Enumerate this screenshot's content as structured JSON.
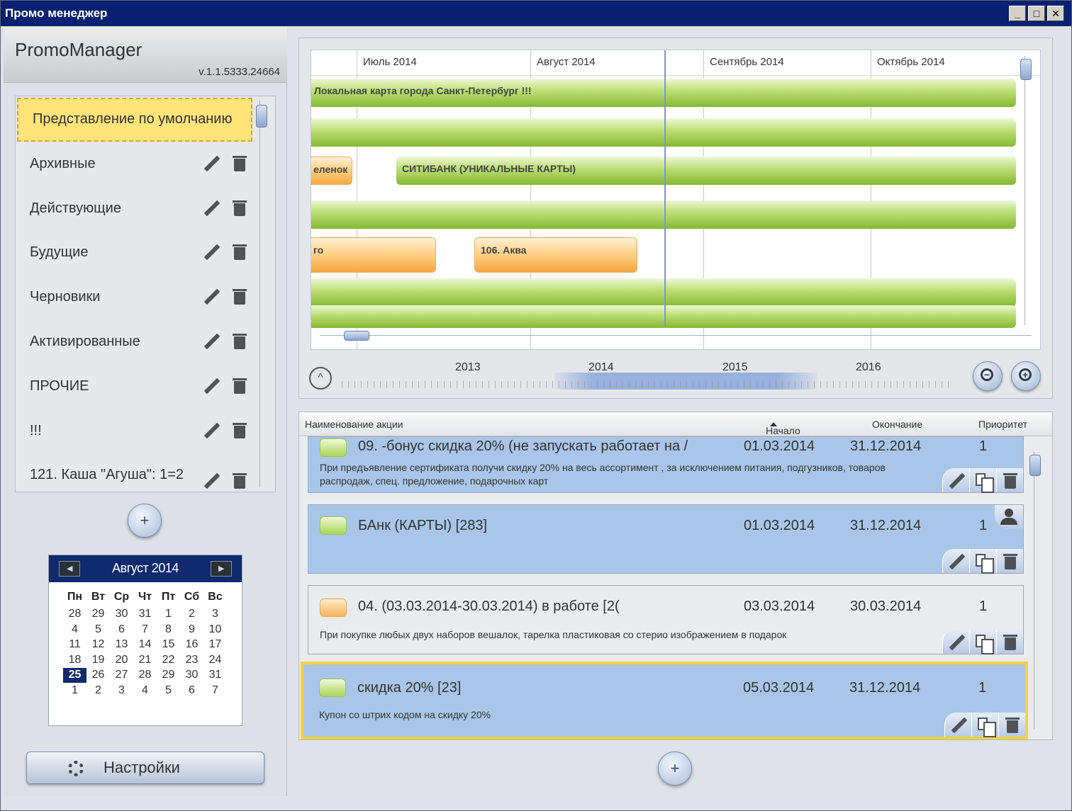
{
  "window": {
    "title": "Промо менеджер",
    "min": "_",
    "max": "□",
    "close": "✕"
  },
  "brand": {
    "name": "PromoManager",
    "version": "v.1.1.5333.24664"
  },
  "views": [
    {
      "label": "Представление по умолчанию"
    },
    {
      "label": "Архивные"
    },
    {
      "label": "Действующие"
    },
    {
      "label": "Будущие"
    },
    {
      "label": "Черновики"
    },
    {
      "label": "Активированные"
    },
    {
      "label": "ПРОЧИЕ"
    },
    {
      "label": "!!!"
    },
    {
      "label": "121. Каша \"Агуша\": 1=2"
    }
  ],
  "add_label": "+",
  "calendar": {
    "title": "Август 2014",
    "prev": "◀",
    "next": "▶",
    "dow": [
      "Пн",
      "Вт",
      "Ср",
      "Чт",
      "Пт",
      "Сб",
      "Вс"
    ],
    "days": [
      "28",
      "29",
      "30",
      "31",
      "1",
      "2",
      "3",
      "4",
      "5",
      "6",
      "7",
      "8",
      "9",
      "10",
      "11",
      "12",
      "13",
      "14",
      "15",
      "16",
      "17",
      "18",
      "19",
      "20",
      "21",
      "22",
      "23",
      "24",
      "25",
      "26",
      "27",
      "28",
      "29",
      "30",
      "31",
      "1",
      "2",
      "3",
      "4",
      "5",
      "6",
      "7"
    ],
    "today": "25"
  },
  "settings": {
    "label": "Настройки"
  },
  "timeline": {
    "months": [
      "Июль 2014",
      "Август 2014",
      "Сентябрь 2014",
      "Октябрь 2014"
    ],
    "bars": [
      {
        "label": "Локальная карта города Санкт-Петербург !!!"
      },
      {
        "label": ""
      },
      {
        "label": "еленок"
      },
      {
        "label": "СИТИБАНК      (УНИКАЛЬНЫЕ КАРТЫ)"
      },
      {
        "label": ""
      },
      {
        "label": "го"
      },
      {
        "label": "106. Аква"
      },
      {
        "label": ""
      },
      {
        "label": ""
      }
    ],
    "years": [
      "2013",
      "2014",
      "2015",
      "2016"
    ],
    "collapse": "^"
  },
  "list": {
    "columns": {
      "name": "Наименование акции",
      "start": "Начало",
      "end": "Окончание",
      "priority": "Приоритет"
    },
    "items": [
      {
        "title": "09.          -бонус скидка 20% (не запускать работает на /",
        "start": "01.03.2014",
        "end": "31.12.2014",
        "priority": "1",
        "desc": "При предъявление сертификата                     получи скидку 20% на весь ассортимент , за исключением питания, подгузников, товаров распродаж, спец. предложение, подарочных карт"
      },
      {
        "title": "        БАнк (КАРТЫ)    [283]",
        "start": "01.03.2014",
        "end": "31.12.2014",
        "priority": "1",
        "desc": ""
      },
      {
        "title": "04.                (03.03.2014-30.03.2014) в работе    [2(",
        "start": "03.03.2014",
        "end": "30.03.2014",
        "priority": "1",
        "desc": "При покупке любых двух наборов вешалок, тарелка пластиковая со стерио изображением в подарок"
      },
      {
        "title": "                  скидка 20%    [23]",
        "start": "05.03.2014",
        "end": "31.12.2014",
        "priority": "1",
        "desc": "Купон со штрих кодом на скидку 20%"
      }
    ]
  }
}
